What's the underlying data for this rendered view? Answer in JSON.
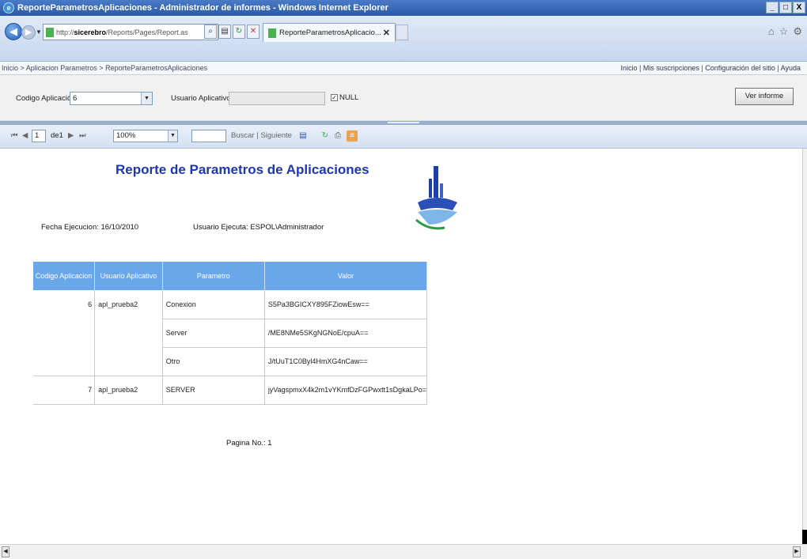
{
  "window": {
    "title": "ReporteParametrosAplicaciones - Administrador de informes - Windows Internet Explorer",
    "controls": [
      "_",
      "□",
      "X"
    ]
  },
  "nav": {
    "address_prefix": "http://",
    "address_host": "sicerebro",
    "address_path": "/Reports/Pages/Report.as",
    "tab_label": "ReporteParametrosAplicacio..."
  },
  "breadcrumb": {
    "path": "Inicio > Aplicacion Parametros > ReporteParametrosAplicaciones",
    "links": [
      "Inicio",
      "Mis suscripciones",
      "Configuración del sitio",
      "Ayuda"
    ]
  },
  "params": {
    "app_code_label": "Codigo Aplicación",
    "app_code_value": "6",
    "user_label": "Usuario Aplicativo",
    "user_value": "",
    "null_label": "NULL",
    "null_checked": true,
    "view_button": "Ver informe"
  },
  "toolbar": {
    "page_current": "1",
    "page_of": "de1",
    "zoom": "100%",
    "find_placeholder": "",
    "find_label": "Buscar | Siguiente"
  },
  "report": {
    "title": "Reporte de Parametros de Aplicaciones",
    "fecha_label": "Fecha Ejecucion: 16/10/2010",
    "usuario_label": "Usuario Ejecuta: ESPOL\\Administrador",
    "columns": [
      "Codigo Aplicacion",
      "Usuario Aplicativo",
      "Parametro",
      "Valor"
    ],
    "rows": [
      {
        "codigo": "6",
        "usuario": "apl_prueba2",
        "parametro": "Conexion",
        "valor": "S5Pa3BGICXY895FZiowEsw=="
      },
      {
        "codigo": "",
        "usuario": "",
        "parametro": "Server",
        "valor": "/ME8NMe5SKgNGNoE/cpuA=="
      },
      {
        "codigo": "",
        "usuario": "",
        "parametro": "Otro",
        "valor": "J/tUuT1C0Byl4HmXG4nCaw=="
      },
      {
        "codigo": "7",
        "usuario": "apl_prueba2",
        "parametro": "SERVER",
        "valor": "jyVagspmxX4k2m1vYKmfDzFGPwxtt1sDgkaLPo="
      }
    ],
    "footer": "Pagina No.: 1"
  }
}
